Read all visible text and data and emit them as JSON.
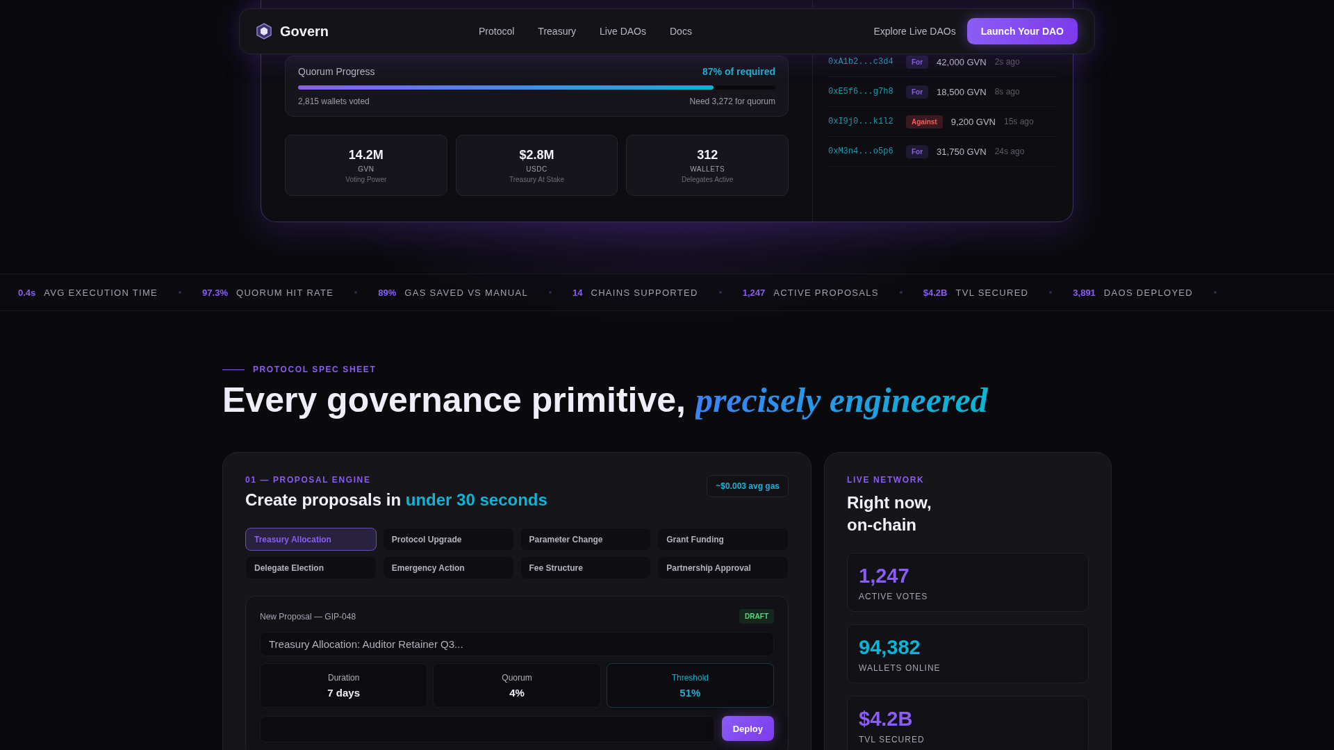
{
  "nav": {
    "brand": "Govern",
    "links": [
      "Protocol",
      "Treasury",
      "Live DAOs",
      "Docs"
    ],
    "secondary_link": "Explore Live DAOs",
    "cta": "Launch Your DAO"
  },
  "dashboard": {
    "quorum": {
      "label": "Quorum Progress",
      "percent_text": "87% of required",
      "level": 0.87,
      "voted": "2,815 wallets voted",
      "need": "Need 3,272 for quorum"
    },
    "stats": [
      {
        "value": "14.2M",
        "unit": "GVN",
        "caption": "Voting Power"
      },
      {
        "value": "$2.8M",
        "unit": "USDC",
        "caption": "Treasury At Stake"
      },
      {
        "value": "312",
        "unit": "WALLETS",
        "caption": "Delegates Active"
      }
    ],
    "votes": [
      {
        "address": "0xA1b2...c3d4",
        "vote": "For",
        "kind": "for",
        "amount": "42,000 GVN",
        "time": "2s ago"
      },
      {
        "address": "0xE5f6...g7h8",
        "vote": "For",
        "kind": "for",
        "amount": "18,500 GVN",
        "time": "8s ago"
      },
      {
        "address": "0xI9j0...k1l2",
        "vote": "Against",
        "kind": "against",
        "amount": "9,200 GVN",
        "time": "15s ago"
      },
      {
        "address": "0xM3n4...o5p6",
        "vote": "For",
        "kind": "for",
        "amount": "31,750 GVN",
        "time": "24s ago"
      }
    ]
  },
  "ticker": [
    {
      "value": "0.4s",
      "label": "AVG EXECUTION TIME"
    },
    {
      "value": "97.3%",
      "label": "QUORUM HIT RATE"
    },
    {
      "value": "89%",
      "label": "GAS SAVED VS MANUAL"
    },
    {
      "value": "14",
      "label": "CHAINS SUPPORTED"
    },
    {
      "value": "1,247",
      "label": "ACTIVE PROPOSALS"
    },
    {
      "value": "$4.2B",
      "label": "TVL SECURED"
    },
    {
      "value": "3,891",
      "label": "DAOS DEPLOYED"
    }
  ],
  "section": {
    "eyebrow": "PROTOCOL SPEC SHEET",
    "headline": "Every governance primitive,",
    "headline_accent": "precisely engineered"
  },
  "proposal_card": {
    "eyebrow": "01 — PROPOSAL ENGINE",
    "title": "Create proposals in",
    "title_accent": "under 30 seconds",
    "gas_badge": "~$0.003 avg gas",
    "types": [
      {
        "label": "Treasury Allocation",
        "selected": true
      },
      {
        "label": "Protocol Upgrade",
        "selected": false
      },
      {
        "label": "Parameter Change",
        "selected": false
      },
      {
        "label": "Grant Funding",
        "selected": false
      },
      {
        "label": "Delegate Election",
        "selected": false
      },
      {
        "label": "Emergency Action",
        "selected": false
      },
      {
        "label": "Fee Structure",
        "selected": false
      },
      {
        "label": "Partnership Approval",
        "selected": false
      }
    ],
    "draft": {
      "title": "New Proposal — GIP-048",
      "status": "DRAFT",
      "title_value": "Treasury Allocation: Auditor Retainer Q3...",
      "params": [
        {
          "label": "Duration",
          "value": "7 days",
          "selected": false
        },
        {
          "label": "Quorum",
          "value": "4%",
          "selected": false
        },
        {
          "label": "Threshold",
          "value": "51%",
          "selected": true
        }
      ],
      "deploy": "Deploy"
    }
  },
  "live_network": {
    "eyebrow": "LIVE NETWORK",
    "title_lines": [
      "Right now,",
      "on-chain"
    ],
    "stats": [
      {
        "value": "1,247",
        "label": "ACTIVE VOTES",
        "color": "#8b5cf6"
      },
      {
        "value": "94,382",
        "label": "WALLETS ONLINE",
        "color": "#06b6d4"
      },
      {
        "value": "$4.2B",
        "label": "TVL SECURED",
        "color": "#8b5cf6"
      }
    ]
  }
}
